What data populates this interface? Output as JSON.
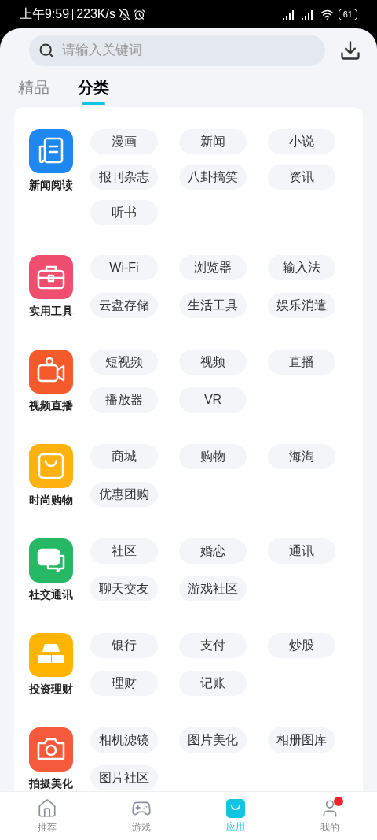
{
  "status_bar": {
    "time": "上午9:59",
    "speed": "223K/s",
    "battery": "61"
  },
  "search": {
    "placeholder": "请输入关键词"
  },
  "tabs": [
    {
      "label": "精品",
      "selected": false
    },
    {
      "label": "分类",
      "selected": true
    }
  ],
  "categories": [
    {
      "name": "新闻阅读",
      "kind": "newspaper",
      "color": "#1e88f0",
      "tags": [
        "漫画",
        "新闻",
        "小说",
        "报刊杂志",
        "八卦搞笑",
        "资讯",
        "听书"
      ]
    },
    {
      "name": "实用工具",
      "kind": "toolbox",
      "color": "#f04e6e",
      "tags": [
        "Wi-Fi",
        "浏览器",
        "输入法",
        "云盘存储",
        "生活工具",
        "娱乐消遣"
      ]
    },
    {
      "name": "视频直播",
      "kind": "video",
      "color": "#f45a2c",
      "tags": [
        "短视频",
        "视频",
        "直播",
        "播放器",
        "VR"
      ]
    },
    {
      "name": "时尚购物",
      "kind": "bag",
      "color": "#ffb20f",
      "tags": [
        "商城",
        "购物",
        "海淘",
        "优惠团购"
      ]
    },
    {
      "name": "社交通讯",
      "kind": "chat",
      "color": "#26b865",
      "tags": [
        "社区",
        "婚恋",
        "通讯",
        "聊天交友",
        "游戏社区"
      ]
    },
    {
      "name": "投资理财",
      "kind": "gold",
      "color": "#ffb400",
      "tags": [
        "银行",
        "支付",
        "炒股",
        "理财",
        "记账"
      ]
    },
    {
      "name": "拍摄美化",
      "kind": "camera",
      "color": "#f55a3c",
      "tags": [
        "相机滤镜",
        "图片美化",
        "相册图库",
        "图片社区"
      ]
    }
  ],
  "bottom_nav": [
    {
      "label": "推荐",
      "kind": "home",
      "selected": false,
      "badge": false
    },
    {
      "label": "游戏",
      "kind": "game",
      "selected": false,
      "badge": false
    },
    {
      "label": "应用",
      "kind": "apps",
      "selected": true,
      "badge": false
    },
    {
      "label": "我的",
      "kind": "user",
      "selected": false,
      "badge": true
    }
  ]
}
